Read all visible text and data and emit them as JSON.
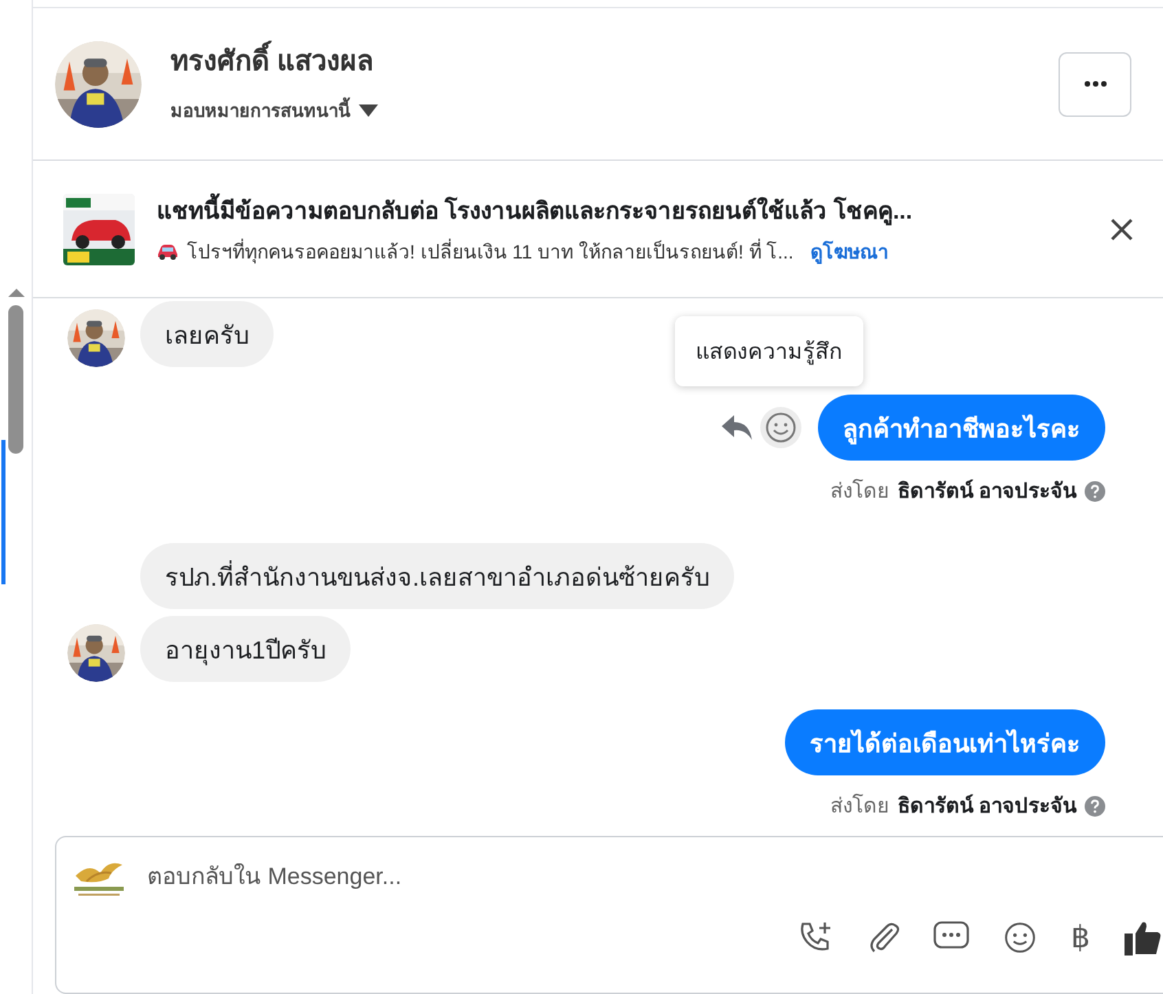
{
  "header": {
    "name": "ทรงศักดิ์ แสวงผล",
    "assign_label": "มอบหมายการสนทนานี้"
  },
  "ad": {
    "title": "แชทนี้มีข้อความตอบกลับต่อ โรงงานผลิตและกระจายรถยนต์ใช้แล้ว โชคคู...",
    "text": "โปรฯที่ทุกคนรอคอยมาแล้ว! เปลี่ยนเงิน 11 บาท ให้กลายเป็นรถยนต์! ที่ โ...",
    "link": "ดูโฆษณา"
  },
  "messages": [
    {
      "kind": "incoming",
      "text": "เลยครับ",
      "avatar": true
    },
    {
      "kind": "outgoing",
      "text": "ลูกค้าทำอาชีพอะไรคะ",
      "sent_by_label": "ส่งโดย",
      "sender": "ธิดารัตน์ อาจประจัน",
      "hovered": true,
      "tooltip": "แสดงความรู้สึก"
    },
    {
      "kind": "incoming",
      "text": "รปภ.ที่สำนักงานขนส่งจ.เลยสาขาอำเภอด่นซ้ายครับ",
      "avatar": false
    },
    {
      "kind": "incoming",
      "text": "อายุงาน1ปีครับ",
      "avatar": true
    },
    {
      "kind": "outgoing",
      "text": "รายได้ต่อเดือนเท่าไหร่คะ",
      "sent_by_label": "ส่งโดย",
      "sender": "ธิดารัตน์ อาจประจัน",
      "hovered": false
    }
  ],
  "composer": {
    "placeholder": "ตอบกลับใน Messenger...",
    "currency_symbol": "฿"
  }
}
